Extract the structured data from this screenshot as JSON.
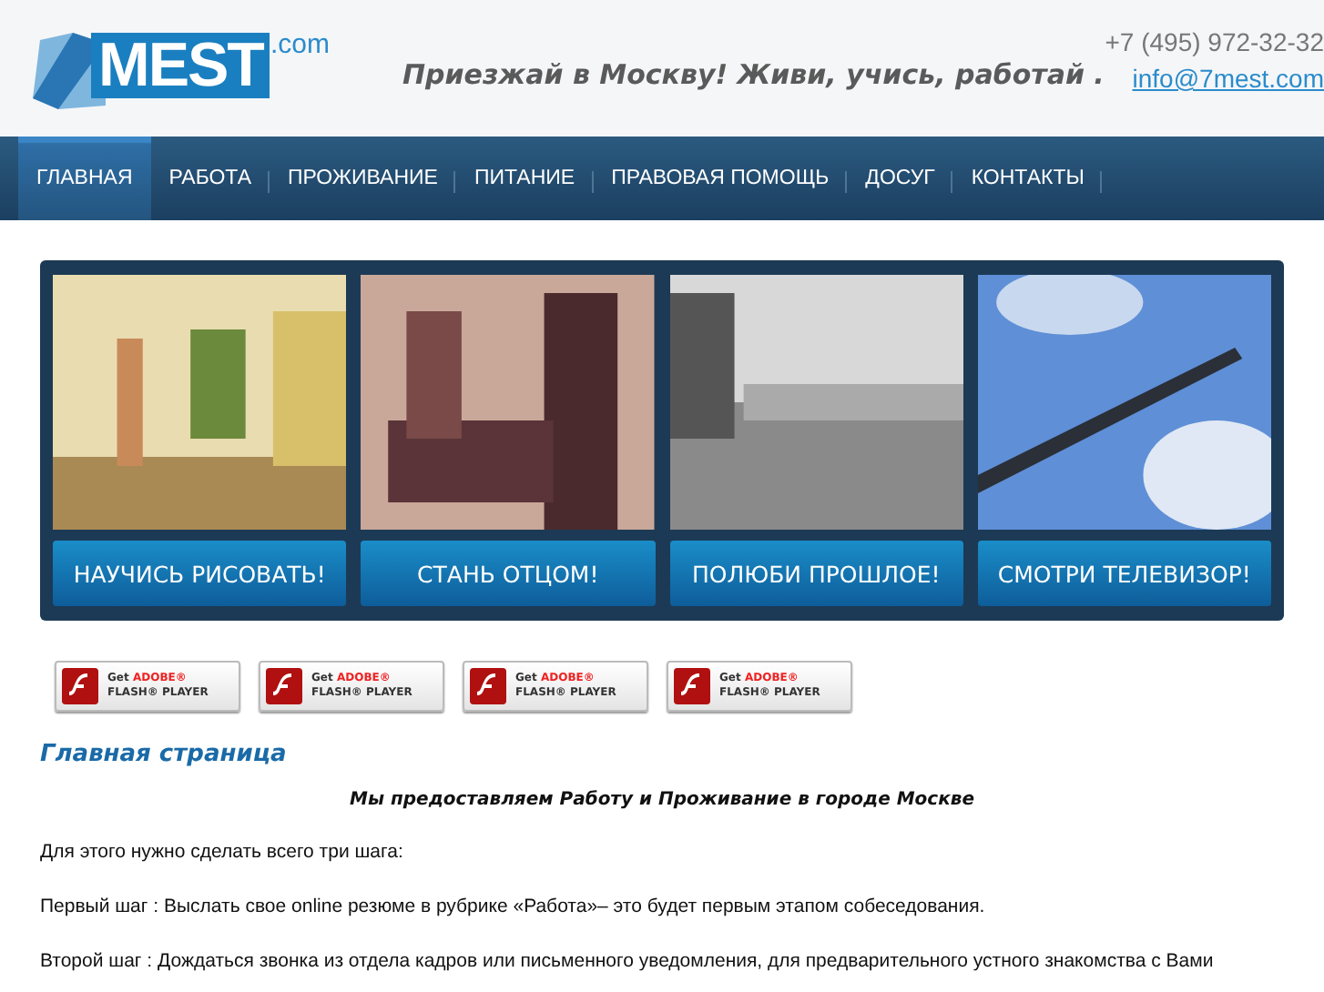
{
  "header": {
    "logo": {
      "word": "MEST",
      "suffix": ".com"
    },
    "slogan": "Приезжай в Москву! Живи, учись, работай .",
    "phone": "+7 (495) 972-32-32",
    "email": "info@7mest.com"
  },
  "nav": [
    {
      "label": "ГЛАВНАЯ",
      "selected": true
    },
    {
      "label": "РАБОТА",
      "selected": false
    },
    {
      "label": "ПРОЖИВАНИЕ",
      "selected": false
    },
    {
      "label": "ПИТАНИЕ",
      "selected": false
    },
    {
      "label": "ПРАВОВАЯ ПОМОЩЬ",
      "selected": false
    },
    {
      "label": "ДОСУГ",
      "selected": false
    },
    {
      "label": "КОНТАКТЫ",
      "selected": false
    }
  ],
  "promos": [
    {
      "kind": "street",
      "button": "НАУЧИСЬ РИСОВАТЬ!"
    },
    {
      "kind": "silhouette",
      "button": "СТАНЬ ОТЦОМ!"
    },
    {
      "kind": "oldphoto",
      "button": "ПОЛЮБИ ПРОШЛОЕ!"
    },
    {
      "kind": "sky",
      "button": "СМОТРИ ТЕЛЕВИЗОР!"
    }
  ],
  "flash_badges": [
    {
      "get": "Get",
      "brand": "ADOBE®",
      "product": "FLASH® PLAYER"
    },
    {
      "get": "Get",
      "brand": "ADOBE®",
      "product": "FLASH® PLAYER"
    },
    {
      "get": "Get",
      "brand": "ADOBE®",
      "product": "FLASH® PLAYER"
    },
    {
      "get": "Get",
      "brand": "ADOBE®",
      "product": "FLASH® PLAYER"
    }
  ],
  "content": {
    "heading": "Главная страница",
    "lead": "Мы предоставляем Работу и Проживание в городе Москве",
    "paragraphs": [
      "Для этого нужно сделать всего три шага:",
      "Первый шаг : Выслать свое online резюме в рубрике «Работа»– это будет первым этапом собеседования.",
      "Второй шаг : Дождаться звонка из отдела кадров или письменного уведомления, для предварительного устного знакомства с Вами"
    ]
  }
}
